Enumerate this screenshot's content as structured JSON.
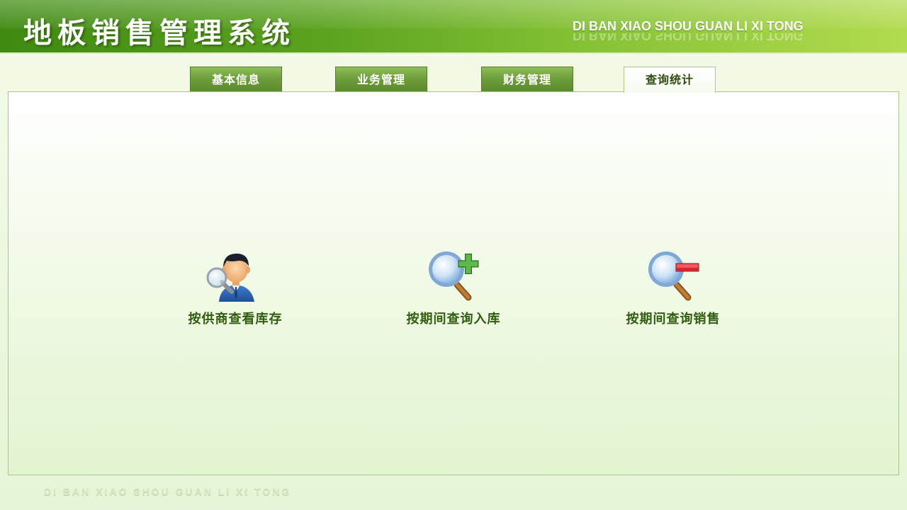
{
  "header": {
    "title": "地板销售管理系统",
    "subtitle": "DI BAN XIAO SHOU GUAN LI XI TONG"
  },
  "tabs": [
    {
      "label": "基本信息",
      "active": false
    },
    {
      "label": "业务管理",
      "active": false
    },
    {
      "label": "财务管理",
      "active": false
    },
    {
      "label": "查询统计",
      "active": true
    }
  ],
  "actions": [
    {
      "label": "按供商查看库存",
      "icon": "person-magnifier-icon"
    },
    {
      "label": "按期间查询入库",
      "icon": "magnifier-plus-icon"
    },
    {
      "label": "按期间查询销售",
      "icon": "magnifier-minus-icon"
    }
  ],
  "footer": {
    "text": "DI BAN XIAO SHOU GUAN LI XI TONG"
  },
  "colors": {
    "brand_green": "#4a9418",
    "label_green": "#2f5d0e",
    "plus_green": "#3f9a2e",
    "minus_red": "#e0323a"
  }
}
